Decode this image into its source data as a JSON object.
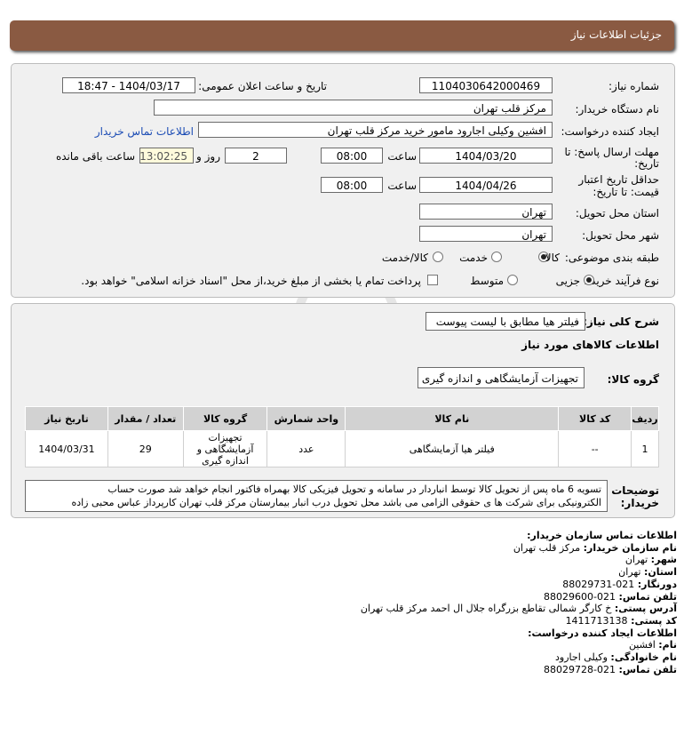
{
  "header": {
    "title": "جزئیات اطلاعات نیاز"
  },
  "form": {
    "need_number_label": "شماره نیاز:",
    "need_number": "1104030642000469",
    "announce_label": "تاریخ و ساعت اعلان عمومی:",
    "announce_value": "1404/03/17 - 18:47",
    "buyer_org_label": "نام دستگاه خریدار:",
    "buyer_org": "مرکز قلب تهران",
    "creator_label": "ایجاد کننده درخواست:",
    "creator": "افشین وکیلی اجارود مامور خرید مرکز قلب تهران",
    "buyer_contact_link": "اطلاعات تماس خریدار",
    "deadline_label_1": "مهلت ارسال پاسخ: تا",
    "deadline_label_2": "تاریخ:",
    "deadline_date": "1404/03/20",
    "time_label": "ساعت",
    "deadline_time": "08:00",
    "days_value": "2",
    "days_label": "روز و",
    "remaining_time": "13:02:25",
    "remaining_label": "ساعت باقی مانده",
    "validity_label_1": "حداقل تاریخ اعتبار",
    "validity_label_2": "قیمت: تا تاریخ:",
    "validity_date": "1404/04/26",
    "validity_time_label": "ساعت",
    "validity_time": "08:00",
    "province_label": "استان محل تحویل:",
    "province": "تهران",
    "city_label": "شهر محل تحویل:",
    "city": "تهران",
    "category_label": "طبقه بندی موضوعی:",
    "category_options": [
      "کالا",
      "خدمت",
      "کالا/خدمت"
    ],
    "process_label": "نوع فرآیند خرید :",
    "process_options": [
      "جزیی",
      "متوسط"
    ],
    "payment_note": "پرداخت تمام یا بخشی از مبلغ خرید،از محل \"اسناد خزانه اسلامی\" خواهد بود."
  },
  "details": {
    "summary_label": "شرح کلی نیاز:",
    "summary_value": "فیلتر هیا مطابق با لیست پیوست",
    "goods_info_title": "اطلاعات کالاهای مورد نیاز",
    "goods_group_label": "گروه کالا:",
    "goods_group_value": "تجهیزات آزمایشگاهی و اندازه گیری",
    "table": {
      "headers": [
        "ردیف",
        "کد کالا",
        "نام کالا",
        "واحد شمارش",
        "گروه کالا",
        "تعداد / مقدار",
        "تاریخ نیاز"
      ],
      "rows": [
        [
          "1",
          "--",
          "فیلتر هیا آزمایشگاهی",
          "عدد",
          "تجهیزات آزمایشگاهی و اندازه گیری",
          "29",
          "1404/03/31"
        ]
      ]
    },
    "buyer_notes_label_1": "توضیحات",
    "buyer_notes_label_2": "خریدار:",
    "buyer_notes_line1": "تسویه 6 ماه پس از تحویل کالا توسط انباردار در سامانه و تحویل فیزیکی کالا بهمراه فاکتور انجام خواهد شد صورت حساب",
    "buyer_notes_line2": "الکترونیکی برای شرکت ها ی حقوقی الزامی می باشد محل تحویل درب انبار بیمارستان مرکز قلب تهران کارپرداز عباس محبی زاده"
  },
  "contact": {
    "title": "اطلاعات تماس سازمان خریدار:",
    "org_label": "نام سازمان خریدار:",
    "org": "مرکز قلب تهران",
    "city_label": "شهر:",
    "city": "تهران",
    "province_label": "استان:",
    "province": "تهران",
    "fax_label": "دورنگار:",
    "fax": "021-88029731",
    "phone_label": "تلفن تماس:",
    "phone": "021-88029600",
    "address_label": "آدرس پستی:",
    "address": "خ کارگر شمالی تقاطع بزرگراه جلال ال احمد مرکز قلب تهران",
    "postal_label": "کد پستی:",
    "postal": "1411713138",
    "creator_title": "اطلاعات ایجاد کننده درخواست:",
    "name_label": "نام:",
    "name": "افشین",
    "family_label": "نام خانوادگی:",
    "family": "وکیلی اجارود",
    "creator_phone_label": "تلفن تماس:",
    "creator_phone": "021-88029728"
  },
  "watermark": {
    "text": "ParsNamadData",
    "colors": {
      "wm": "#dcdcdc"
    }
  }
}
